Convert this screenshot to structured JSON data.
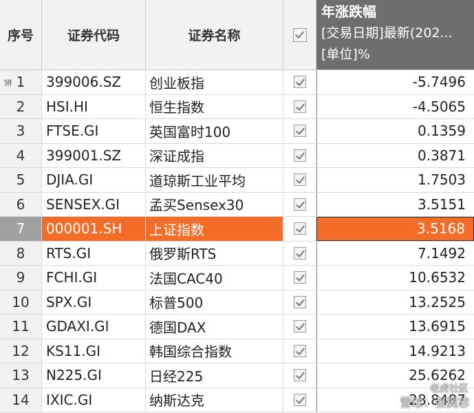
{
  "headers": {
    "index": "序号",
    "code": "证券代码",
    "name": "证券名称",
    "metric_title": "年涨跌幅",
    "metric_date": "[交易日期]最新(202...",
    "metric_unit": "[单位]%"
  },
  "selected_row": 7,
  "colors": {
    "selected": "#f46d28",
    "header_dark": "#6e6e6e"
  },
  "rows": [
    {
      "idx": "1",
      "code": "399006.SZ",
      "name": "创业板指",
      "value": "-5.7496",
      "checked": true
    },
    {
      "idx": "2",
      "code": "HSI.HI",
      "name": "恒生指数",
      "value": "-4.5065",
      "checked": true
    },
    {
      "idx": "3",
      "code": "FTSE.GI",
      "name": "英国富时100",
      "value": "0.1359",
      "checked": true
    },
    {
      "idx": "4",
      "code": "399001.SZ",
      "name": "深证成指",
      "value": "0.3871",
      "checked": true
    },
    {
      "idx": "5",
      "code": "DJIA.GI",
      "name": "道琼斯工业平均",
      "value": "1.7503",
      "checked": true
    },
    {
      "idx": "6",
      "code": "SENSEX.GI",
      "name": "孟买Sensex30",
      "value": "3.5151",
      "checked": true
    },
    {
      "idx": "7",
      "code": "000001.SH",
      "name": "上证指数",
      "value": "3.5168",
      "checked": true
    },
    {
      "idx": "8",
      "code": "RTS.GI",
      "name": "俄罗斯RTS",
      "value": "7.1492",
      "checked": true
    },
    {
      "idx": "9",
      "code": "FCHI.GI",
      "name": "法国CAC40",
      "value": "10.6532",
      "checked": true
    },
    {
      "idx": "10",
      "code": "SPX.GI",
      "name": "标普500",
      "value": "13.2525",
      "checked": true
    },
    {
      "idx": "11",
      "code": "GDAXI.GI",
      "name": "德国DAX",
      "value": "13.6915",
      "checked": true
    },
    {
      "idx": "12",
      "code": "KS11.GI",
      "name": "韩国综合指数",
      "value": "14.9213",
      "checked": true
    },
    {
      "idx": "13",
      "code": "N225.GI",
      "name": "日经225",
      "value": "25.6262",
      "checked": true
    },
    {
      "idx": "14",
      "code": "IXIC.GI",
      "name": "纳斯达克",
      "value": "28.8487",
      "checked": true
    }
  ],
  "watermark": {
    "line1": "雪球：张翼轸",
    "line2": "老虎社区"
  }
}
